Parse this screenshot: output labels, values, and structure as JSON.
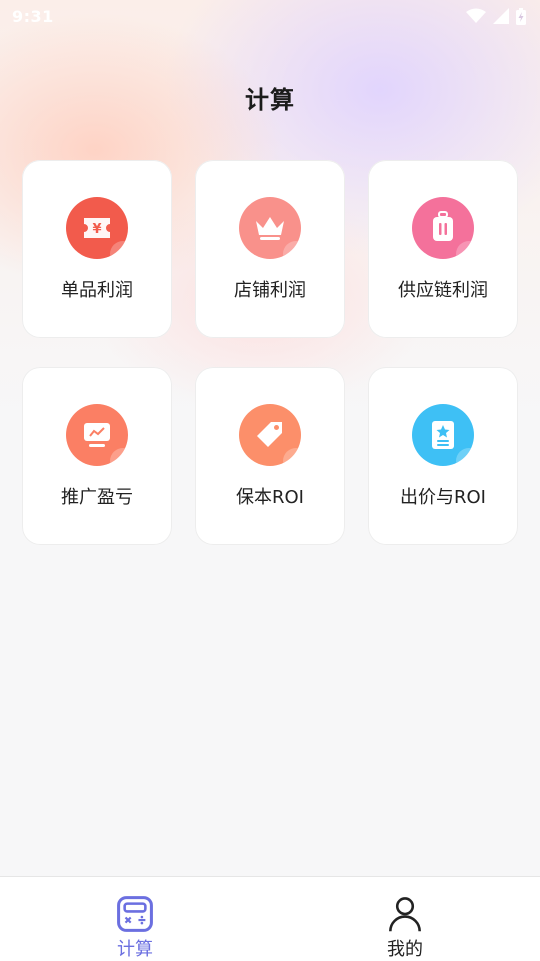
{
  "status_bar": {
    "time": "9:31"
  },
  "page": {
    "title": "计算"
  },
  "cards": [
    {
      "label": "单品利润",
      "icon": "coupon-yen-icon",
      "color": "#f25b4c"
    },
    {
      "label": "店铺利润",
      "icon": "crown-icon",
      "color": "#f9918b"
    },
    {
      "label": "供应链利润",
      "icon": "luggage-icon",
      "color": "#f4719b"
    },
    {
      "label": "推广盈亏",
      "icon": "monitor-chart-icon",
      "color": "#fb7f64"
    },
    {
      "label": "保本ROI",
      "icon": "price-tag-icon",
      "color": "#fc8f6a"
    },
    {
      "label": "出价与ROI",
      "icon": "star-document-icon",
      "color": "#3ec0f5"
    }
  ],
  "tabs": [
    {
      "label": "计算",
      "icon": "calculator-icon",
      "active": true,
      "color": "#6b6fe0"
    },
    {
      "label": "我的",
      "icon": "person-icon",
      "active": false,
      "color": "#222222"
    }
  ]
}
